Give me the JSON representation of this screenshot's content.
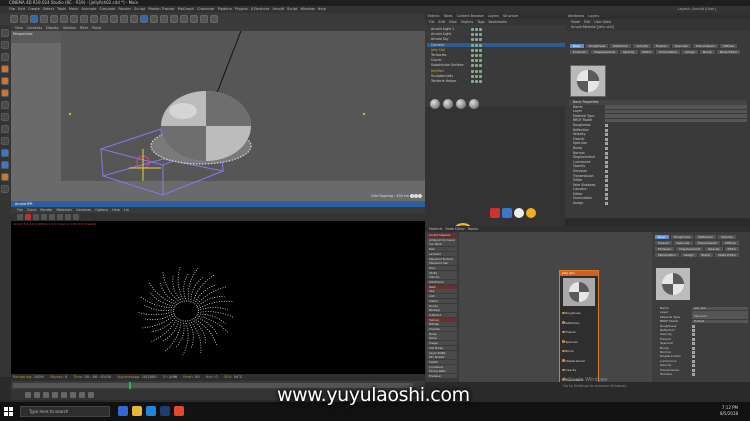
{
  "window": {
    "title": "CINEMA 4D R19.024 Studio (RC - R19) - [jellyfish02.c4d *] - Main",
    "layout": "Layout:",
    "layout_value": "Arnold (User)"
  },
  "menubar": [
    "File",
    "Edit",
    "Create",
    "Select",
    "Tools",
    "Mesh",
    "Animate",
    "Simulate",
    "Render",
    "Sculpt",
    "Motion Tracker",
    "MoGraph",
    "Character",
    "Pipeline",
    "Plugins",
    "X-Particles",
    "Arnold",
    "Script",
    "Window",
    "Help"
  ],
  "viewport": {
    "menu": [
      "View",
      "Cameras",
      "Display",
      "Options",
      "Filter",
      "Panel"
    ],
    "label": "Perspective",
    "grid_label": "Grid Spacing : 100 cm"
  },
  "render_view": {
    "title": "Arnold IPR",
    "menu": [
      "File",
      "Cloud",
      "Render",
      "Materials",
      "Cameras",
      "Options",
      "Help",
      "Lm"
    ],
    "info": "Arnold 5.0.2.0 (C4DtoA 2.2.2)  Device: CPU  [16 threads]"
  },
  "status": {
    "rendering": "Rendering:",
    "rendering_val": "100%",
    "mbs": "Mb/sec:",
    "mbs_val": "0",
    "time": "Time:",
    "time_val": "00 : 00 : 01:00",
    "spp": "Spp/maxspp:",
    "spp_val": "10/1000",
    "tri": "Tri:",
    "tri_val": "0/96",
    "mesh": "Mesh:",
    "mesh_val": "50",
    "hair": "Hair:",
    "hair_val": "0",
    "gpu": "GPU:",
    "gpu_val": "54°C"
  },
  "object_manager": {
    "tabs": [
      "Objects",
      "Takes",
      "Content Browser",
      "Layers",
      "Structure"
    ],
    "menu": [
      "File",
      "Edit",
      "View",
      "Objects",
      "Tags",
      "Bookmarks"
    ],
    "objects": [
      {
        "name": "Arnold Light 1"
      },
      {
        "name": "Arnold Light"
      },
      {
        "name": "Arnold Sky"
      },
      {
        "name": "Camera"
      },
      {
        "name": "Jelly Cell"
      },
      {
        "name": "Tentacles"
      },
      {
        "name": "Cloner"
      },
      {
        "name": "Subdivision Surface"
      },
      {
        "name": "Jellyfish"
      },
      {
        "name": "Sculpted Jelly"
      },
      {
        "name": "Tentacle Helper"
      }
    ]
  },
  "attributes": {
    "tabs": [
      "Attributes",
      "Layers"
    ],
    "mode_menu": [
      "Mode",
      "Edit",
      "User Data"
    ],
    "header": "Arnold Material [jelly skin]",
    "channel_chips": [
      "Basic",
      "Roughness",
      "Reflection",
      "Velocity",
      "Fresnel",
      "Specular",
      "Transmission",
      "Diffuse",
      "Emission",
      "Displacement",
      "Opacity",
      "Editor",
      "Illumination",
      "Assign",
      "Bump",
      "Node Editor"
    ],
    "section": "Basic Properties",
    "props": [
      {
        "k": "Name",
        "type": "field"
      },
      {
        "k": "Layer",
        "type": "field"
      },
      {
        "k": "Material Type",
        "type": "field"
      },
      {
        "k": "BRDF Model",
        "type": "field"
      },
      {
        "k": "Roughness",
        "type": "check"
      },
      {
        "k": "Reflection",
        "type": "check"
      },
      {
        "k": "Velocity",
        "type": "check"
      },
      {
        "k": "Fresnel",
        "type": "check"
      },
      {
        "k": "Specular",
        "type": "check"
      },
      {
        "k": "Bump",
        "type": "check"
      },
      {
        "k": "Normal",
        "type": "check"
      },
      {
        "k": "Displacement",
        "type": "check"
      },
      {
        "k": "Luminance",
        "type": "check"
      },
      {
        "k": "Opacity",
        "type": "check"
      },
      {
        "k": "Emission",
        "type": "check"
      },
      {
        "k": "Transmission",
        "type": "check"
      },
      {
        "k": "Editor",
        "type": "check"
      },
      {
        "k": "Fake Shadows",
        "type": "check"
      },
      {
        "k": "Caustics",
        "type": "check"
      },
      {
        "k": "Editor",
        "type": "check"
      },
      {
        "k": "Illumination",
        "type": "check"
      },
      {
        "k": "Assign",
        "type": "check"
      }
    ]
  },
  "node_editor": {
    "tabs": [
      "Material",
      "Node Editor",
      "Nodes"
    ],
    "list": [
      {
        "label": "Arnold Shaders",
        "h": true
      },
      {
        "label": "Ambient Occlusion"
      },
      {
        "label": "Car Paint"
      },
      {
        "label": "Hair"
      },
      {
        "label": "Lambert"
      },
      {
        "label": "Standard Surface"
      },
      {
        "label": "Standard Hair"
      },
      {
        "label": "Toon"
      },
      {
        "label": "Utility"
      },
      {
        "label": "Volume"
      },
      {
        "label": "Wireframe"
      },
      {
        "label": "Math",
        "h": true
      },
      {
        "label": "Abs"
      },
      {
        "label": "Add"
      },
      {
        "label": "Clamp"
      },
      {
        "label": "Divide"
      },
      {
        "label": "Multiply"
      },
      {
        "label": "Subtract"
      },
      {
        "label": "Texture",
        "h": true
      },
      {
        "label": "Bitmap"
      },
      {
        "label": "Checker"
      },
      {
        "label": "Noise"
      },
      {
        "label": "Ramp"
      },
      {
        "label": "Image"
      },
      {
        "label": "Cell Noise"
      },
      {
        "label": "Layer RGBA"
      },
      {
        "label": "Mix Shader"
      },
      {
        "label": "Switch"
      },
      {
        "label": "Curvature"
      },
      {
        "label": "Facing Ratio"
      },
      {
        "label": "Triplanar"
      }
    ],
    "node": {
      "title": "jelly skin",
      "ports": [
        "Roughness",
        "Reflection",
        "Fresnel",
        "Specular",
        "Bump",
        "Displacement",
        "Opacity",
        "Transmission",
        "Normal"
      ]
    },
    "attr_props": [
      {
        "k": "Name",
        "v": "jelly skin"
      },
      {
        "k": "Layer",
        "v": ""
      },
      {
        "k": "Material Type",
        "v": "Standard"
      },
      {
        "k": "BRDF Model",
        "v": "Default"
      }
    ],
    "attr_checks": [
      "Roughness",
      "Reflection",
      "Velocity",
      "Fresnel",
      "Specular",
      "Bump",
      "Normal",
      "Displacement",
      "Luminance",
      "Opacity",
      "Transmission",
      "Window"
    ]
  },
  "watermark": {
    "line1": "Activate Windows",
    "line2": "Go to Settings to activate Windows."
  },
  "taskbar": {
    "search": "Type here to search",
    "time": "7:12 PM",
    "date": "8/5/2018"
  },
  "overlay_url": "www.yuyulaoshi.com",
  "colors": {
    "accent": "#2e5c92",
    "node_orange": "#d06020",
    "timeline_green": "#2db45a",
    "status_orange": "#c88a2a",
    "cursor_yellow": "#f0c419"
  }
}
